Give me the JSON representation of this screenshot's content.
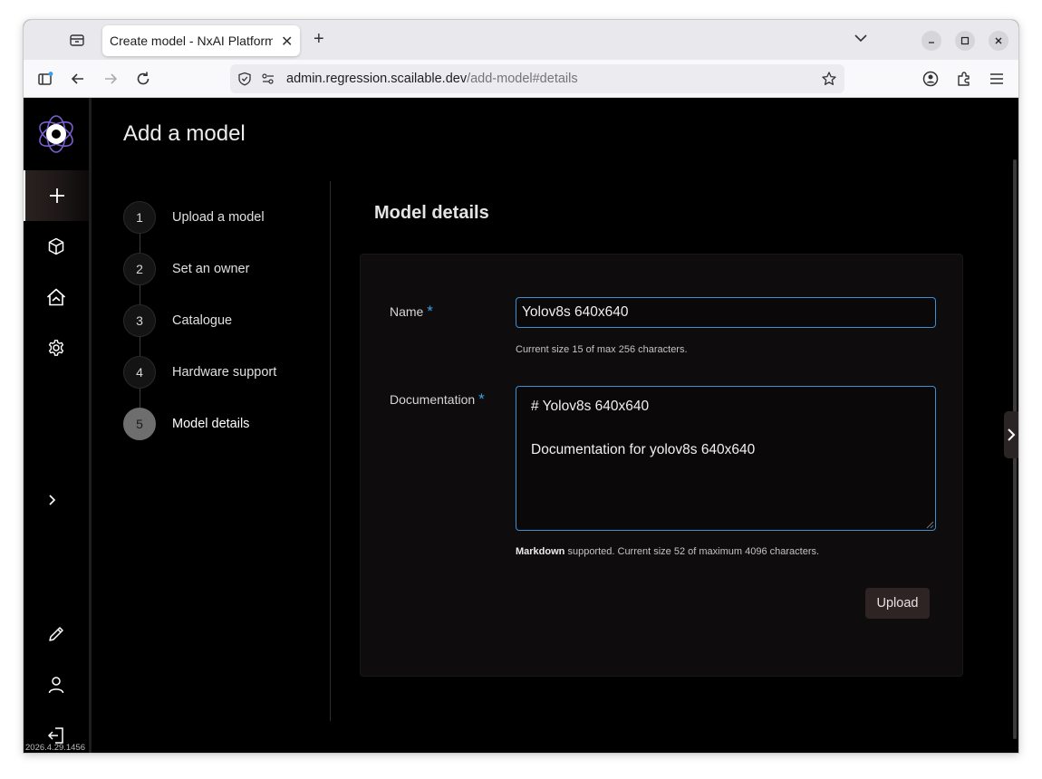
{
  "browser": {
    "tab_title": "Create model - NxAI Platform",
    "tab_close": "✕",
    "new_tab": "+",
    "url_host": "admin.regression.scailable.dev",
    "url_path": "/add-model#details"
  },
  "sidebar": {
    "version": "2026.4.29.1456",
    "items": [
      {
        "name": "add",
        "icon": "plus-icon"
      },
      {
        "name": "models",
        "icon": "cube-icon"
      },
      {
        "name": "home",
        "icon": "home-icon"
      },
      {
        "name": "settings",
        "icon": "gear-icon"
      },
      {
        "name": "expand",
        "icon": "chevron-right-icon"
      },
      {
        "name": "edit",
        "icon": "pencil-icon"
      },
      {
        "name": "account",
        "icon": "user-icon"
      },
      {
        "name": "logout",
        "icon": "logout-icon"
      }
    ]
  },
  "page": {
    "title": "Add a model",
    "steps": [
      {
        "number": "1",
        "label": "Upload a model"
      },
      {
        "number": "2",
        "label": "Set an owner"
      },
      {
        "number": "3",
        "label": "Catalogue"
      },
      {
        "number": "4",
        "label": "Hardware support"
      },
      {
        "number": "5",
        "label": "Model details"
      }
    ],
    "active_step": 5
  },
  "form": {
    "section_title": "Model details",
    "name_label": "Name",
    "required_mark": "*",
    "name_value": "Yolov8s 640x640",
    "name_help": "Current size 15 of max 256 characters.",
    "doc_label": "Documentation",
    "doc_value": "# Yolov8s 640x640\n\nDocumentation for yolov8s 640x640",
    "doc_help_bold": "Markdown",
    "doc_help_rest": " supported. Current size 52 of maximum 4096 characters.",
    "upload_label": "Upload"
  },
  "colors": {
    "accent": "#3e8fd6",
    "background": "#000000",
    "card": "#0e0c0c",
    "button": "#2e2424",
    "logo": "#7b5fd0"
  }
}
